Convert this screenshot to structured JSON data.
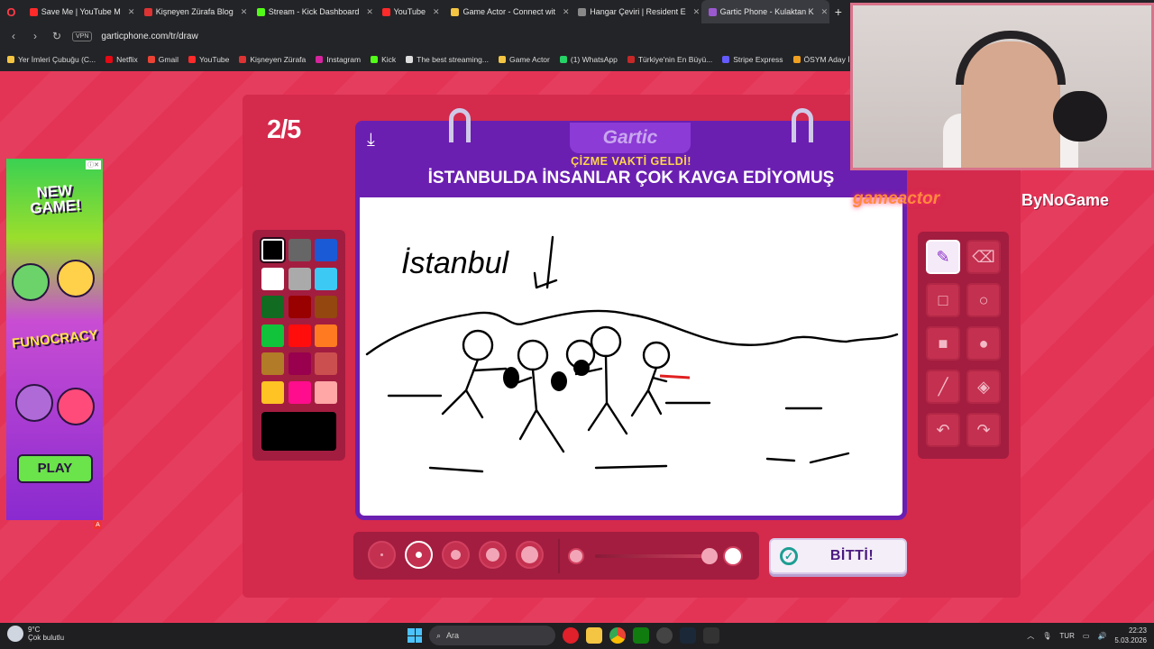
{
  "browser": {
    "tabs": [
      {
        "label": "Save Me | YouTube M",
        "color": "#ff2a2a"
      },
      {
        "label": "Kişneyen Zürafa Blog",
        "color": "#d33"
      },
      {
        "label": "Stream - Kick Dashboard",
        "color": "#53fc18"
      },
      {
        "label": "YouTube",
        "color": "#ff2a2a"
      },
      {
        "label": "Game Actor - Connect wit",
        "color": "#f4c542"
      },
      {
        "label": "Hangar Çeviri | Resident E",
        "color": "#888"
      },
      {
        "label": "Gartic Phone - Kulaktan K",
        "color": "#9b59d0",
        "active": true
      }
    ],
    "url": "garticphone.com/tr/draw",
    "vpn": "VPN",
    "bookmarks": [
      {
        "label": "Yer İmleri Çubuğu (C...",
        "color": "#f4c542"
      },
      {
        "label": "Netflix",
        "color": "#e50914"
      },
      {
        "label": "Gmail",
        "color": "#ea4335"
      },
      {
        "label": "YouTube",
        "color": "#ff2a2a"
      },
      {
        "label": "Kişneyen Zürafa",
        "color": "#d33"
      },
      {
        "label": "Instagram",
        "color": "#d6249f"
      },
      {
        "label": "Kick",
        "color": "#53fc18"
      },
      {
        "label": "The best streaming...",
        "color": "#ddd"
      },
      {
        "label": "Game Actor",
        "color": "#f4c542"
      },
      {
        "label": "(1) WhatsApp",
        "color": "#25d366"
      },
      {
        "label": "Türkiye'nin En Büyü...",
        "color": "#c62828"
      },
      {
        "label": "Stripe Express",
        "color": "#635bff"
      },
      {
        "label": "ÖSYM Aday İşlemle...",
        "color": "#f0a020"
      }
    ]
  },
  "ad": {
    "new_game": "NEW GAME!",
    "funocracy": "FUNOCRACY",
    "play": "PLAY"
  },
  "game": {
    "round": "2/5",
    "logo": "Gartic",
    "subtitle": "ÇİZME VAKTİ GELDİ!",
    "prompt": "İSTANBULDA İNSANLAR ÇOK KAVGA EDİYOMUŞ",
    "drawing_text": "İstanbul",
    "done_label": "BİTTİ!",
    "palette": [
      "#000000",
      "#666666",
      "#1a5ad6",
      "#ffffff",
      "#aaaaaa",
      "#3ccaf4",
      "#116b21",
      "#990000",
      "#94470f",
      "#10c33a",
      "#ff0d0d",
      "#ff7a21",
      "#b27b27",
      "#99004d",
      "#cc4f4f",
      "#ffc324",
      "#ff0d8c",
      "#ffa6a6"
    ],
    "selected_color": "#000000",
    "tools": [
      "pen-icon",
      "eraser-icon",
      "rectangle-outline-icon",
      "ellipse-outline-icon",
      "rectangle-fill-icon",
      "ellipse-fill-icon",
      "line-icon",
      "fill-bucket-icon",
      "undo-icon",
      "redo-icon"
    ],
    "brush_sizes": 5,
    "selected_brush_size": 2
  },
  "stream_overlay": {
    "brand_left": "gameactor",
    "brand_right": "ByNoGame"
  },
  "taskbar": {
    "temperature": "9°C",
    "weather": "Çok bulutlu",
    "search": "Ara",
    "language": "TUR",
    "time": "22:23",
    "date": "5.03.2026"
  }
}
